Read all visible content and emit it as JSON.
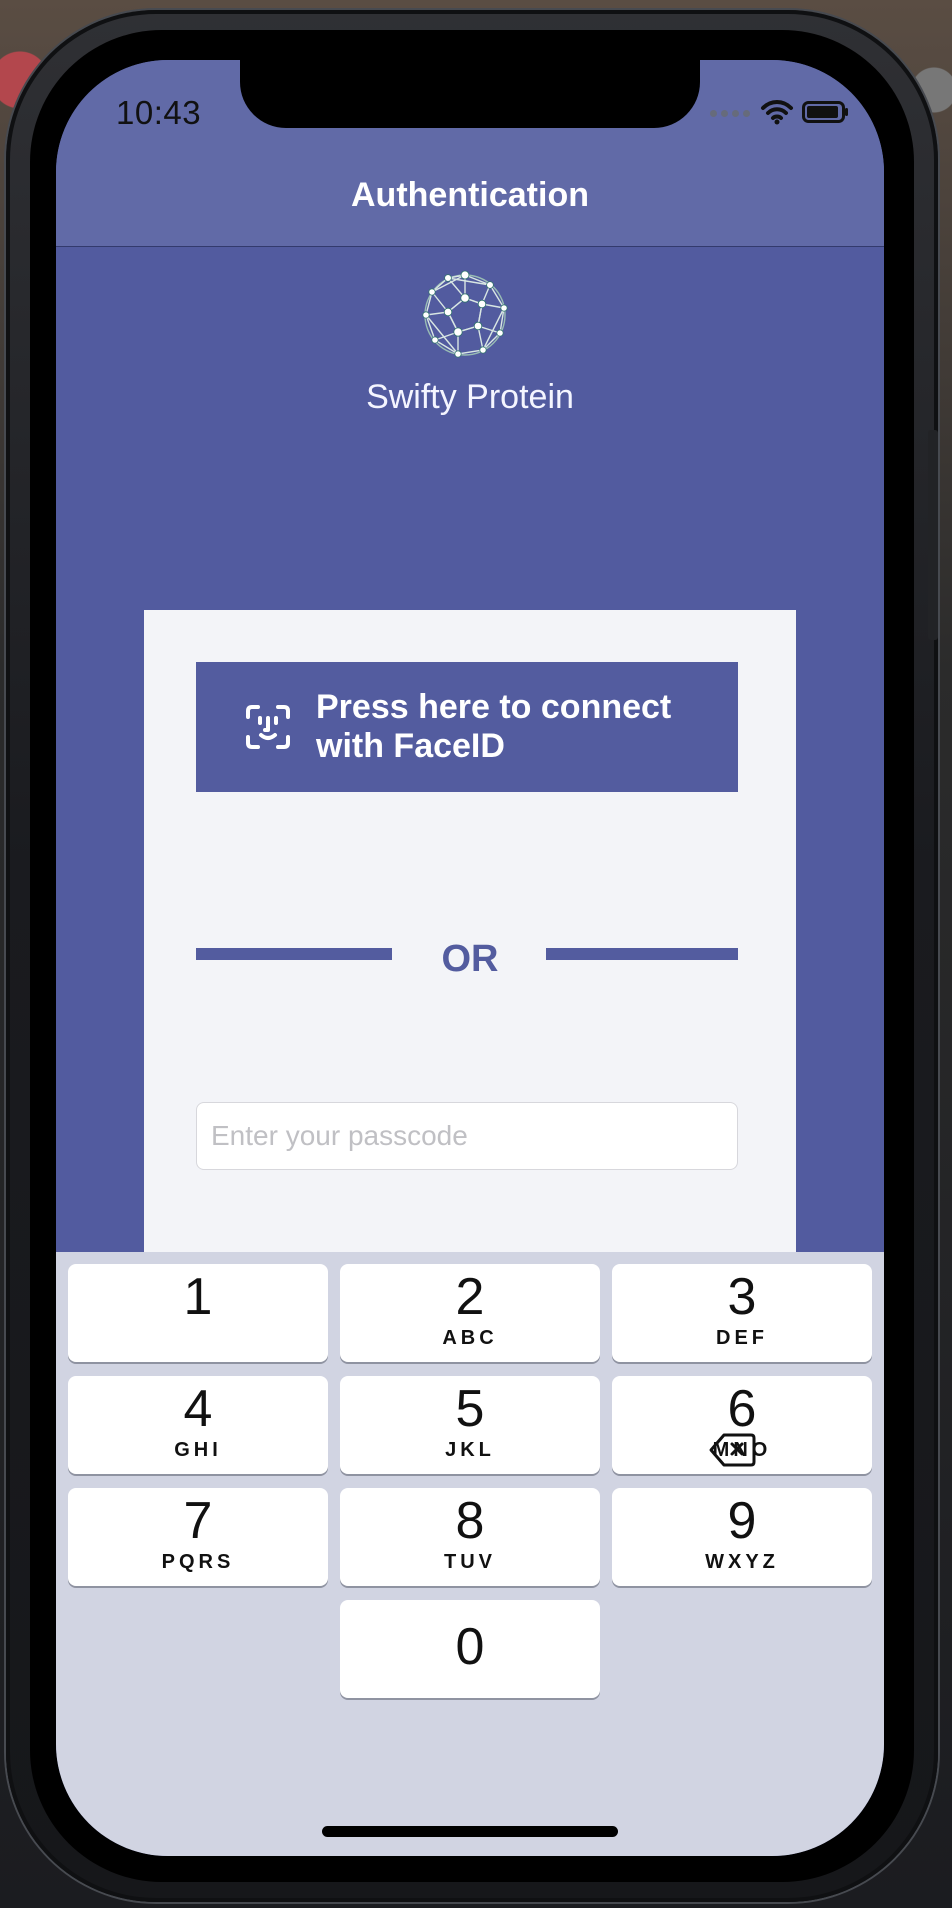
{
  "status_bar": {
    "time": "10:43"
  },
  "navbar": {
    "title": "Authentication"
  },
  "app": {
    "name": "Swifty Protein",
    "logo_icon": "molecule-icon"
  },
  "auth": {
    "faceid_button_label": "Press here to connect with FaceID",
    "faceid_icon": "faceid-icon",
    "separator_label": "OR",
    "passcode_placeholder": "Enter your passcode"
  },
  "keyboard": {
    "keys": [
      {
        "number": "1",
        "letters": ""
      },
      {
        "number": "2",
        "letters": "ABC"
      },
      {
        "number": "3",
        "letters": "DEF"
      },
      {
        "number": "4",
        "letters": "GHI"
      },
      {
        "number": "5",
        "letters": "JKL"
      },
      {
        "number": "6",
        "letters": "MNO"
      },
      {
        "number": "7",
        "letters": "PQRS"
      },
      {
        "number": "8",
        "letters": "TUV"
      },
      {
        "number": "9",
        "letters": "WXYZ"
      },
      {
        "number": "0",
        "letters": ""
      }
    ],
    "delete_icon": "backspace-icon"
  },
  "colors": {
    "primary": "#535c9f",
    "header": "#616aa7",
    "card": "#f3f4f8",
    "keyboard": "#d1d4e2"
  }
}
